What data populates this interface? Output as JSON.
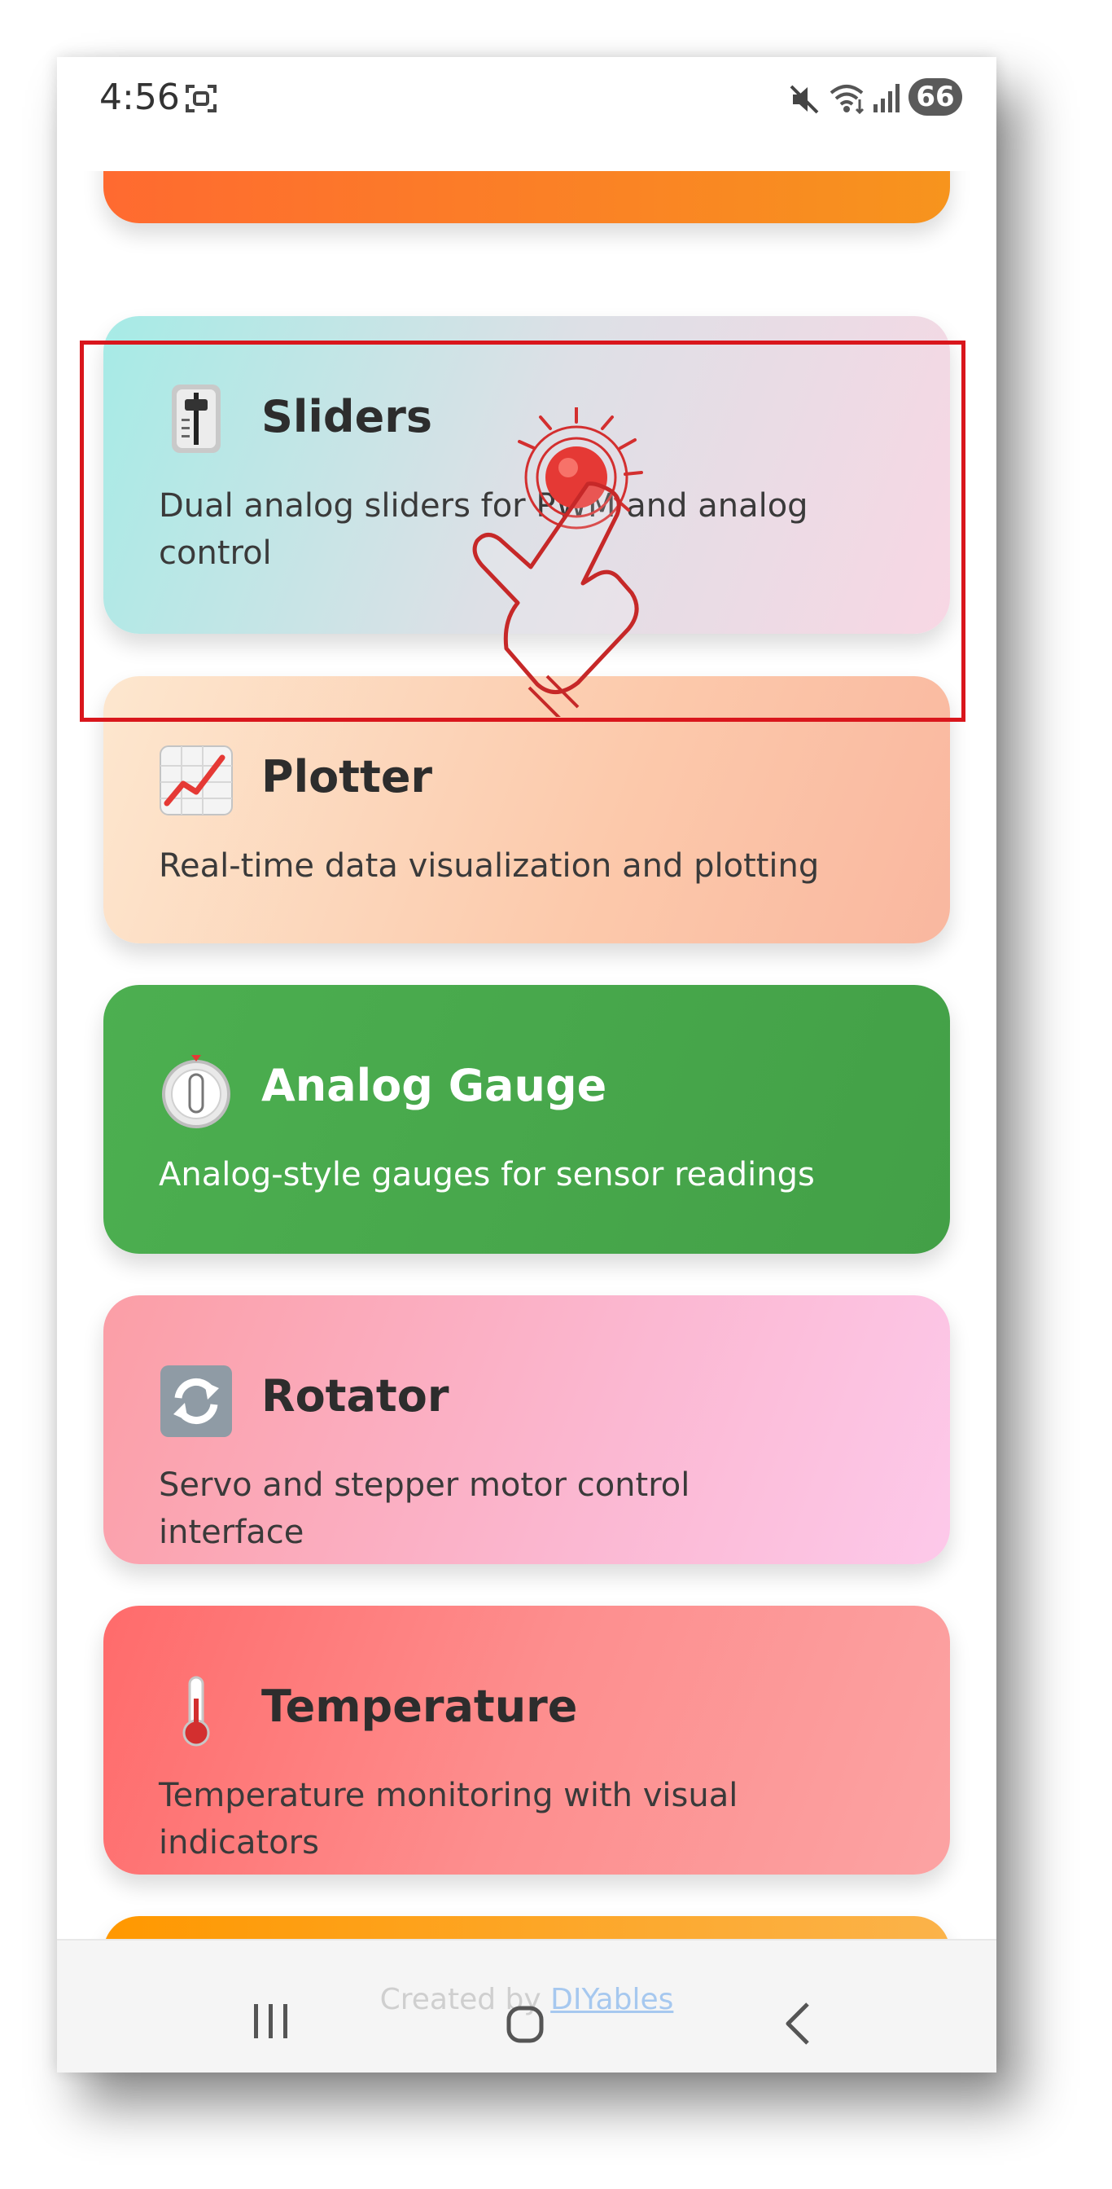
{
  "status_bar": {
    "time": "4:56",
    "battery": "66"
  },
  "cards": [
    {
      "id": "sliders",
      "title": "Sliders",
      "description": "Dual analog sliders for PWM and analog control",
      "icon": "slider-control-icon"
    },
    {
      "id": "plotter",
      "title": "Plotter",
      "description": "Real-time data visualization and plotting",
      "icon": "chart-increasing-icon"
    },
    {
      "id": "gauge",
      "title": "Analog Gauge",
      "description": "Analog-style gauges for sensor readings",
      "icon": "timer-clock-icon"
    },
    {
      "id": "rotator",
      "title": "Rotator",
      "description": "Servo and stepper motor control interface",
      "icon": "rotate-arrows-icon"
    },
    {
      "id": "temperature",
      "title": "Temperature",
      "description": "Temperature monitoring with visual indicators",
      "icon": "thermometer-icon"
    }
  ],
  "footer": {
    "prefix": "Created by ",
    "link": "DIYables"
  },
  "colors": {
    "highlight": "#d9161c",
    "sliders_card": "#a6ebe6",
    "plotter_card": "#fcc9ab",
    "gauge_card": "#4caf50",
    "rotator_card": "#fbb8d2",
    "temperature_card": "#ff6b6b",
    "top_card": "#f7941d",
    "next_card": "#ff9800"
  }
}
